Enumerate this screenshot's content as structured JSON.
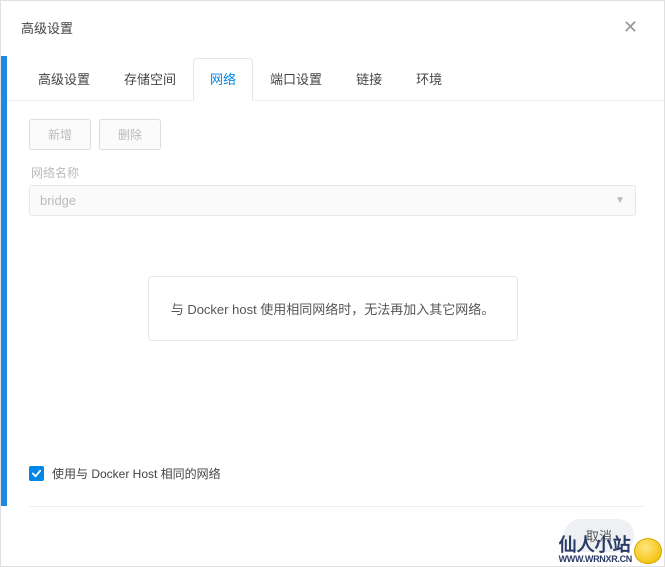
{
  "header": {
    "title": "高级设置"
  },
  "tabs": [
    {
      "label": "高级设置"
    },
    {
      "label": "存储空间"
    },
    {
      "label": "网络"
    },
    {
      "label": "端口设置"
    },
    {
      "label": "链接"
    },
    {
      "label": "环境"
    }
  ],
  "toolbar": {
    "add": "新增",
    "delete": "删除"
  },
  "network": {
    "label": "网络名称",
    "value": "bridge"
  },
  "info": "与 Docker host 使用相同网络时，无法再加入其它网络。",
  "checkbox": {
    "label": "使用与 Docker Host 相同的网络",
    "checked": true
  },
  "buttons": {
    "cancel": "取消"
  },
  "watermark": {
    "name": "仙人小站",
    "url": "WWW.WRNXR.CN"
  }
}
